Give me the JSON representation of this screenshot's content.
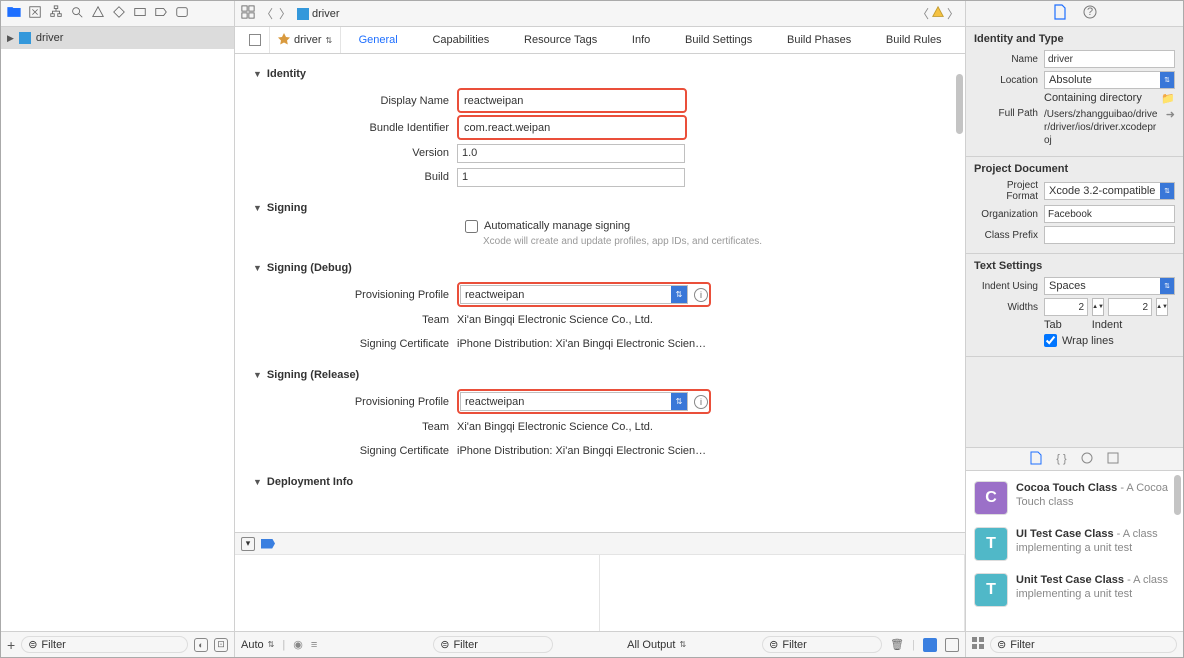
{
  "navigator": {
    "project_name": "driver"
  },
  "breadcrumb": {
    "file": "driver"
  },
  "tabs": {
    "target_name": "driver",
    "items": [
      "General",
      "Capabilities",
      "Resource Tags",
      "Info",
      "Build Settings",
      "Build Phases",
      "Build Rules"
    ],
    "active": "General"
  },
  "identity": {
    "section": "Identity",
    "display_name_label": "Display Name",
    "display_name": "reactweipan",
    "bundle_id_label": "Bundle Identifier",
    "bundle_id": "com.react.weipan",
    "version_label": "Version",
    "version": "1.0",
    "build_label": "Build",
    "build": "1"
  },
  "signing": {
    "section": "Signing",
    "auto_label": "Automatically manage signing",
    "auto_help": "Xcode will create and update profiles, app IDs, and certificates."
  },
  "signing_debug": {
    "section": "Signing (Debug)",
    "profile_label": "Provisioning Profile",
    "profile": "reactweipan",
    "team_label": "Team",
    "team": "Xi'an Bingqi Electronic Science Co., Ltd.",
    "cert_label": "Signing Certificate",
    "cert": "iPhone Distribution: Xi'an Bingqi Electronic Scien…"
  },
  "signing_release": {
    "section": "Signing (Release)",
    "profile_label": "Provisioning Profile",
    "profile": "reactweipan",
    "team_label": "Team",
    "team": "Xi'an Bingqi Electronic Science Co., Ltd.",
    "cert_label": "Signing Certificate",
    "cert": "iPhone Distribution: Xi'an Bingqi Electronic Scien…"
  },
  "deployment": {
    "section": "Deployment Info"
  },
  "bottom": {
    "auto": "Auto",
    "filter1": "Filter",
    "all_output": "All Output",
    "filter2": "Filter"
  },
  "left_bottom": {
    "filter": "Filter"
  },
  "inspector": {
    "identity_title": "Identity and Type",
    "name_label": "Name",
    "name": "driver",
    "location_label": "Location",
    "location": "Absolute",
    "containing": "Containing directory",
    "fullpath_label": "Full Path",
    "fullpath": "/Users/zhangguibao/driver/driver/ios/driver.xcodeproj",
    "doc_title": "Project Document",
    "format_label": "Project Format",
    "format": "Xcode 3.2-compatible",
    "org_label": "Organization",
    "org": "Facebook",
    "prefix_label": "Class Prefix",
    "prefix": "",
    "text_title": "Text Settings",
    "indent_label": "Indent Using",
    "indent": "Spaces",
    "widths_label": "Widths",
    "tab_val": "2",
    "indent_val": "2",
    "tab_cap": "Tab",
    "indent_cap": "Indent",
    "wrap_label": "Wrap lines"
  },
  "library": {
    "items": [
      {
        "icon": "C",
        "icon_type": "c",
        "title": "Cocoa Touch Class",
        "desc": " - A Cocoa Touch class"
      },
      {
        "icon": "T",
        "icon_type": "t",
        "title": "UI Test Case Class",
        "desc": " - A class implementing a unit test"
      },
      {
        "icon": "T",
        "icon_type": "t",
        "title": "Unit Test Case Class",
        "desc": " - A class implementing a unit test"
      }
    ],
    "filter": "Filter"
  }
}
